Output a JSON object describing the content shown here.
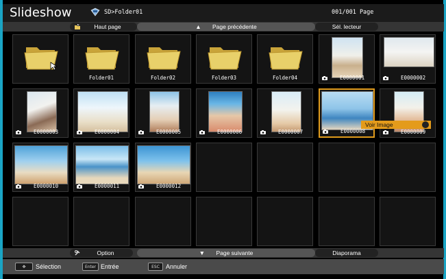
{
  "header": {
    "title": "Slideshow",
    "path": "SD>Folder01",
    "page_count": "001/001 Page"
  },
  "top_nav": {
    "haut_page": "Haut page",
    "page_precedente": "Page précédente",
    "sel_lecteur": "Sél. lecteur"
  },
  "bottom_nav": {
    "option": "Option",
    "page_suivante": "Page suivante",
    "diaporama": "Diaporama"
  },
  "grid": {
    "items": [
      {
        "type": "folder-up",
        "label": ""
      },
      {
        "type": "folder",
        "label": "Folder01"
      },
      {
        "type": "folder",
        "label": "Folder02"
      },
      {
        "type": "folder",
        "label": "Folder03"
      },
      {
        "type": "folder",
        "label": "Folder04"
      },
      {
        "type": "image",
        "label": "E0000001"
      },
      {
        "type": "image",
        "label": "E0000002"
      },
      {
        "type": "image",
        "label": "E0000003"
      },
      {
        "type": "image",
        "label": "E0000004"
      },
      {
        "type": "image",
        "label": "E0000005"
      },
      {
        "type": "image",
        "label": "E0000006"
      },
      {
        "type": "image",
        "label": "E0000007"
      },
      {
        "type": "image",
        "label": "E0000008",
        "selected": true
      },
      {
        "type": "image",
        "label": "E0000009"
      },
      {
        "type": "image",
        "label": "E0000010"
      },
      {
        "type": "image",
        "label": "E0000011"
      },
      {
        "type": "image",
        "label": "E0000012"
      }
    ],
    "tooltip": "Voir Image"
  },
  "footer": {
    "selection": "Sélection",
    "entree_key": "Enter",
    "entree": "Entrée",
    "esc_key": "ESC",
    "annuler": "Annuler"
  },
  "colors": {
    "accent": "#e09b1c",
    "pill": "#222222",
    "navbar": "#353535",
    "frame_edge": "#1aa4c4"
  }
}
